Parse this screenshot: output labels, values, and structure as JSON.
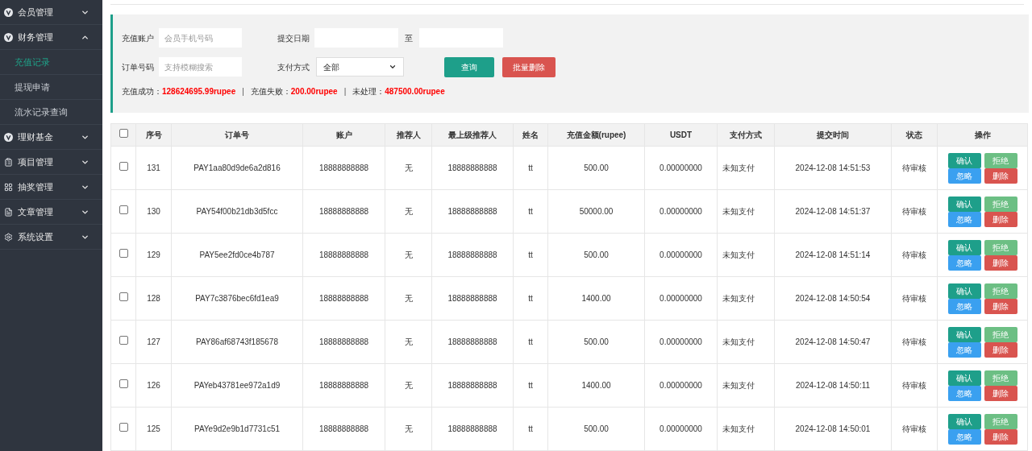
{
  "sidebar": {
    "items": [
      {
        "label": "会员管理",
        "expanded": false
      },
      {
        "label": "财务管理",
        "expanded": true,
        "children": [
          {
            "label": "充值记录",
            "selected": true
          },
          {
            "label": "提现申请",
            "selected": false
          },
          {
            "label": "流水记录查询",
            "selected": false
          }
        ]
      },
      {
        "label": "理财基金",
        "expanded": false
      },
      {
        "label": "项目管理",
        "expanded": false
      },
      {
        "label": "抽奖管理",
        "expanded": false
      },
      {
        "label": "文章管理",
        "expanded": false
      },
      {
        "label": "系统设置",
        "expanded": false
      }
    ]
  },
  "filters": {
    "account": {
      "label": "充值账户",
      "placeholder": "会员手机号码"
    },
    "date": {
      "label": "提交日期",
      "separator": "至"
    },
    "order": {
      "label": "订单号码",
      "placeholder": "支持模糊搜索"
    },
    "payment": {
      "label": "支付方式",
      "value": "全部"
    },
    "buttons": [
      {
        "label": "查询",
        "kind": "primary"
      },
      {
        "label": "批量删除",
        "kind": "danger"
      }
    ],
    "summary": [
      {
        "label": "充值成功：",
        "value": "128624695.99rupee"
      },
      {
        "label": "充值失败：",
        "value": "200.00rupee"
      },
      {
        "label": "未处理：",
        "value": "487500.00rupee"
      }
    ],
    "summary_separator": "|"
  },
  "table": {
    "select_all": {
      "checked": false
    },
    "columns": [
      "序号",
      "订单号",
      "账户",
      "推荐人",
      "最上级推荐人",
      "姓名",
      "充值金额(rupee)",
      "USDT",
      "支付方式",
      "提交时间",
      "状态",
      "操作"
    ],
    "rows": [
      {
        "checked": false,
        "cells": [
          "131",
          "PAY1aa80d9de6a2d816",
          "18888888888",
          "无",
          "18888888888",
          "tt",
          "500.00",
          "0.00000000",
          "未知支付",
          "2024-12-08 14:51:53",
          "待审核"
        ],
        "actions": [
          "确认",
          "拒绝",
          "忽略",
          "删除"
        ]
      },
      {
        "checked": false,
        "cells": [
          "130",
          "PAY54f00b21db3d5fcc",
          "18888888888",
          "无",
          "18888888888",
          "tt",
          "50000.00",
          "0.00000000",
          "未知支付",
          "2024-12-08 14:51:37",
          "待审核"
        ],
        "actions": [
          "确认",
          "拒绝",
          "忽略",
          "删除"
        ]
      },
      {
        "checked": false,
        "cells": [
          "129",
          "PAY5ee2fd0ce4b787",
          "18888888888",
          "无",
          "18888888888",
          "tt",
          "500.00",
          "0.00000000",
          "未知支付",
          "2024-12-08 14:51:14",
          "待审核"
        ],
        "actions": [
          "确认",
          "拒绝",
          "忽略",
          "删除"
        ]
      },
      {
        "checked": false,
        "cells": [
          "128",
          "PAY7c3876bec6fd1ea9",
          "18888888888",
          "无",
          "18888888888",
          "tt",
          "1400.00",
          "0.00000000",
          "未知支付",
          "2024-12-08 14:50:54",
          "待审核"
        ],
        "actions": [
          "确认",
          "拒绝",
          "忽略",
          "删除"
        ]
      },
      {
        "checked": false,
        "cells": [
          "127",
          "PAY86af68743f185678",
          "18888888888",
          "无",
          "18888888888",
          "tt",
          "500.00",
          "0.00000000",
          "未知支付",
          "2024-12-08 14:50:47",
          "待审核"
        ],
        "actions": [
          "确认",
          "拒绝",
          "忽略",
          "删除"
        ]
      },
      {
        "checked": false,
        "cells": [
          "126",
          "PAYeb43781ee972a1d9",
          "18888888888",
          "无",
          "18888888888",
          "tt",
          "1400.00",
          "0.00000000",
          "未知支付",
          "2024-12-08 14:50:11",
          "待审核"
        ],
        "actions": [
          "确认",
          "拒绝",
          "忽略",
          "删除"
        ]
      },
      {
        "checked": false,
        "cells": [
          "125",
          "PAYe9d2e9b1d7731c51",
          "18888888888",
          "无",
          "18888888888",
          "tt",
          "500.00",
          "0.00000000",
          "未知支付",
          "2024-12-08 14:50:01",
          "待审核"
        ],
        "actions": [
          "确认",
          "拒绝",
          "忽略",
          "删除"
        ]
      }
    ]
  }
}
